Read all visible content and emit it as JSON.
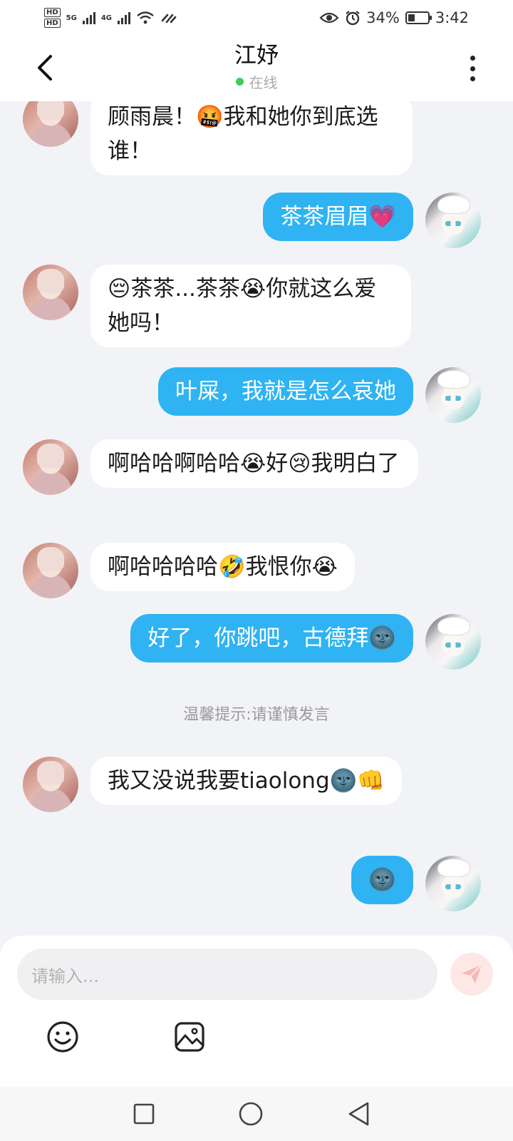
{
  "status_bar": {
    "hd1": "HD",
    "hd2": "HD",
    "net1": "5G",
    "net2": "4G",
    "battery_percent_text": "34%",
    "battery_level": 0.34,
    "time": "3:42"
  },
  "header": {
    "title": "江妤",
    "status": "在线",
    "icons": {
      "back": "chevron-left-icon",
      "more": "more-vertical-icon"
    }
  },
  "messages": [
    {
      "side": "in",
      "text": "顾雨晨！🤬我和她你到底选谁！"
    },
    {
      "side": "out",
      "text": "茶茶眉眉💗"
    },
    {
      "side": "in",
      "text": "😔茶茶...茶茶😭你就这么爱她吗！"
    },
    {
      "side": "out",
      "text": "叶屎，我就是怎么哀她"
    },
    {
      "side": "in",
      "text": "啊哈哈啊哈哈😭好😢我明白了"
    },
    {
      "side": "in",
      "text": "啊哈哈哈哈🤣我恨你😭"
    },
    {
      "side": "out",
      "text": "好了，你跳吧，古德拜🌚"
    },
    {
      "side": "in",
      "text": "我又没说我要tiaolong🌚👊"
    },
    {
      "side": "out",
      "text": "🌚"
    }
  ],
  "notice": "温馨提示:请谨慎发言",
  "composer": {
    "placeholder": "请输入...",
    "icons": {
      "send": "send-icon",
      "emoji": "emoji-icon",
      "image": "image-icon"
    }
  },
  "nav": {
    "icons": [
      "square-recents-icon",
      "circle-home-icon",
      "triangle-back-icon"
    ]
  },
  "colors": {
    "outgoing_bubble": "#2fb3f2",
    "online_dot": "#3fcb5c",
    "send_button_bg": "#fde8e6"
  }
}
